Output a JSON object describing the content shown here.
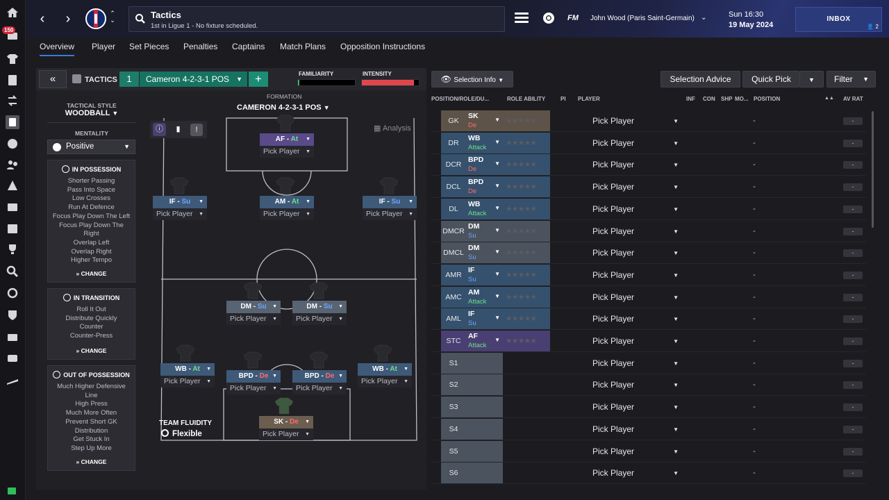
{
  "header": {
    "title": "Tactics",
    "subtitle": "1st in Ligue 1 - No fixture scheduled.",
    "fm_logo": "FM",
    "manager": "John Wood (Paris Saint-Germain)",
    "time": "Sun 16:30",
    "date": "19 May 2024",
    "inbox_label": "INBOX",
    "inbox_count": "2"
  },
  "sidebar": {
    "badge": "150"
  },
  "tabs": [
    {
      "label": "Overview",
      "active": true
    },
    {
      "label": "Player"
    },
    {
      "label": "Set Pieces"
    },
    {
      "label": "Penalties"
    },
    {
      "label": "Captains"
    },
    {
      "label": "Match Plans"
    },
    {
      "label": "Opposition Instructions"
    }
  ],
  "tactic_bar": {
    "tactics_label": "TACTICS",
    "slot": "1",
    "tactic_name": "Cameron 4-2-3-1 POS",
    "familiarity_label": "FAMILIARITY",
    "intensity_label": "INTENSITY",
    "familiarity": 0.02,
    "intensity": 0.92
  },
  "left": {
    "tactical_style_label": "TACTICAL STYLE",
    "tactical_style": "WOODBALL",
    "mentality_label": "MENTALITY",
    "mentality": "Positive",
    "in_possession": {
      "title": "IN POSSESSION",
      "items": [
        "Shorter Passing",
        "Pass Into Space",
        "Low Crosses",
        "Run At Defence",
        "Focus Play Down The Left",
        "Focus Play Down The Right",
        "Overlap Left",
        "Overlap Right",
        "Higher Tempo"
      ],
      "change": "CHANGE"
    },
    "in_transition": {
      "title": "IN TRANSITION",
      "items": [
        "Roll It Out",
        "Distribute Quickly",
        "Counter",
        "Counter-Press"
      ],
      "change": "CHANGE"
    },
    "out_of_possession": {
      "title": "OUT OF POSSESSION",
      "items": [
        "Much Higher Defensive Line",
        "High Press",
        "Much More Often",
        "Prevent Short GK Distribution",
        "Get Stuck In",
        "Step Up More"
      ],
      "change": "CHANGE"
    }
  },
  "pitch": {
    "formation_label": "FORMATION",
    "formation_name": "CAMERON 4-2-3-1 POS",
    "analysis": "Analysis",
    "fluidity_label": "TEAM FLUIDITY",
    "fluidity": "Flexible",
    "pick_player": "Pick Player",
    "players": [
      {
        "role": "AF",
        "duty": "At",
        "duty_class": "duty-at",
        "color": "#5a4a8a"
      },
      {
        "role": "IF",
        "duty": "Su",
        "duty_class": "duty-su",
        "color": "#3f5a78"
      },
      {
        "role": "AM",
        "duty": "At",
        "duty_class": "duty-at",
        "color": "#3f5a78"
      },
      {
        "role": "IF",
        "duty": "Su",
        "duty_class": "duty-su",
        "color": "#3f5a78"
      },
      {
        "role": "DM",
        "duty": "Su",
        "duty_class": "duty-su",
        "color": "#596472"
      },
      {
        "role": "DM",
        "duty": "Su",
        "duty_class": "duty-su",
        "color": "#596472"
      },
      {
        "role": "WB",
        "duty": "At",
        "duty_class": "duty-at",
        "color": "#3f5a78"
      },
      {
        "role": "BPD",
        "duty": "De",
        "duty_class": "duty-de",
        "color": "#3f5a78"
      },
      {
        "role": "BPD",
        "duty": "De",
        "duty_class": "duty-de",
        "color": "#3f5a78"
      },
      {
        "role": "WB",
        "duty": "At",
        "duty_class": "duty-at",
        "color": "#3f5a78"
      },
      {
        "role": "SK",
        "duty": "De",
        "duty_class": "duty-de",
        "color": "#6b5e4f"
      }
    ]
  },
  "right": {
    "selection_info": "Selection Info",
    "selection_advice": "Selection Advice",
    "quick_pick": "Quick Pick",
    "filter": "Filter",
    "columns": {
      "pos": "POSITION/ROLE/DU...",
      "ability": "ROLE ABILITY",
      "pi": "PI",
      "player": "PLAYER",
      "inf": "INF",
      "con": "CON",
      "shp": "SHP",
      "mo": "MO...",
      "position": "POSITION",
      "av_rat": "AV RAT"
    },
    "rows": [
      {
        "pos": "GK",
        "role": "SK",
        "duty": "De",
        "duty_class": "duty-de",
        "color": "#5e5348",
        "player": "Pick Player",
        "position": "-",
        "rat": "-"
      },
      {
        "pos": "DR",
        "role": "WB",
        "duty": "Attack",
        "duty_class": "duty-at",
        "color": "#35516d",
        "player": "Pick Player",
        "position": "-",
        "rat": "-"
      },
      {
        "pos": "DCR",
        "role": "BPD",
        "duty": "De",
        "duty_class": "duty-de",
        "color": "#35516d",
        "player": "Pick Player",
        "position": "-",
        "rat": "-"
      },
      {
        "pos": "DCL",
        "role": "BPD",
        "duty": "De",
        "duty_class": "duty-de",
        "color": "#35516d",
        "player": "Pick Player",
        "position": "-",
        "rat": "-"
      },
      {
        "pos": "DL",
        "role": "WB",
        "duty": "Attack",
        "duty_class": "duty-at",
        "color": "#35516d",
        "player": "Pick Player",
        "position": "-",
        "rat": "-"
      },
      {
        "pos": "DMCR",
        "role": "DM",
        "duty": "Su",
        "duty_class": "duty-su",
        "color": "#4b535e",
        "player": "Pick Player",
        "position": "-",
        "rat": "-"
      },
      {
        "pos": "DMCL",
        "role": "DM",
        "duty": "Su",
        "duty_class": "duty-su",
        "color": "#4b535e",
        "player": "Pick Player",
        "position": "-",
        "rat": "-"
      },
      {
        "pos": "AMR",
        "role": "IF",
        "duty": "Su",
        "duty_class": "duty-su",
        "color": "#35516d",
        "player": "Pick Player",
        "position": "-",
        "rat": "-"
      },
      {
        "pos": "AMC",
        "role": "AM",
        "duty": "Attack",
        "duty_class": "duty-at",
        "color": "#35516d",
        "player": "Pick Player",
        "position": "-",
        "rat": "-"
      },
      {
        "pos": "AML",
        "role": "IF",
        "duty": "Su",
        "duty_class": "duty-su",
        "color": "#35516d",
        "player": "Pick Player",
        "position": "-",
        "rat": "-"
      },
      {
        "pos": "STC",
        "role": "AF",
        "duty": "Attack",
        "duty_class": "duty-at",
        "color": "#4a3f72",
        "player": "Pick Player",
        "position": "-",
        "rat": "-"
      },
      {
        "pos": "S1",
        "role": "",
        "duty": "",
        "duty_class": "",
        "color": "#4b535e",
        "player": "Pick Player",
        "position": "-",
        "rat": "-"
      },
      {
        "pos": "S2",
        "role": "",
        "duty": "",
        "duty_class": "",
        "color": "#4b535e",
        "player": "Pick Player",
        "position": "-",
        "rat": "-"
      },
      {
        "pos": "S3",
        "role": "",
        "duty": "",
        "duty_class": "",
        "color": "#4b535e",
        "player": "Pick Player",
        "position": "-",
        "rat": "-"
      },
      {
        "pos": "S4",
        "role": "",
        "duty": "",
        "duty_class": "",
        "color": "#4b535e",
        "player": "Pick Player",
        "position": "-",
        "rat": "-"
      },
      {
        "pos": "S5",
        "role": "",
        "duty": "",
        "duty_class": "",
        "color": "#4b535e",
        "player": "Pick Player",
        "position": "-",
        "rat": "-"
      },
      {
        "pos": "S6",
        "role": "",
        "duty": "",
        "duty_class": "",
        "color": "#4b535e",
        "player": "Pick Player",
        "position": "-",
        "rat": "-"
      }
    ]
  }
}
